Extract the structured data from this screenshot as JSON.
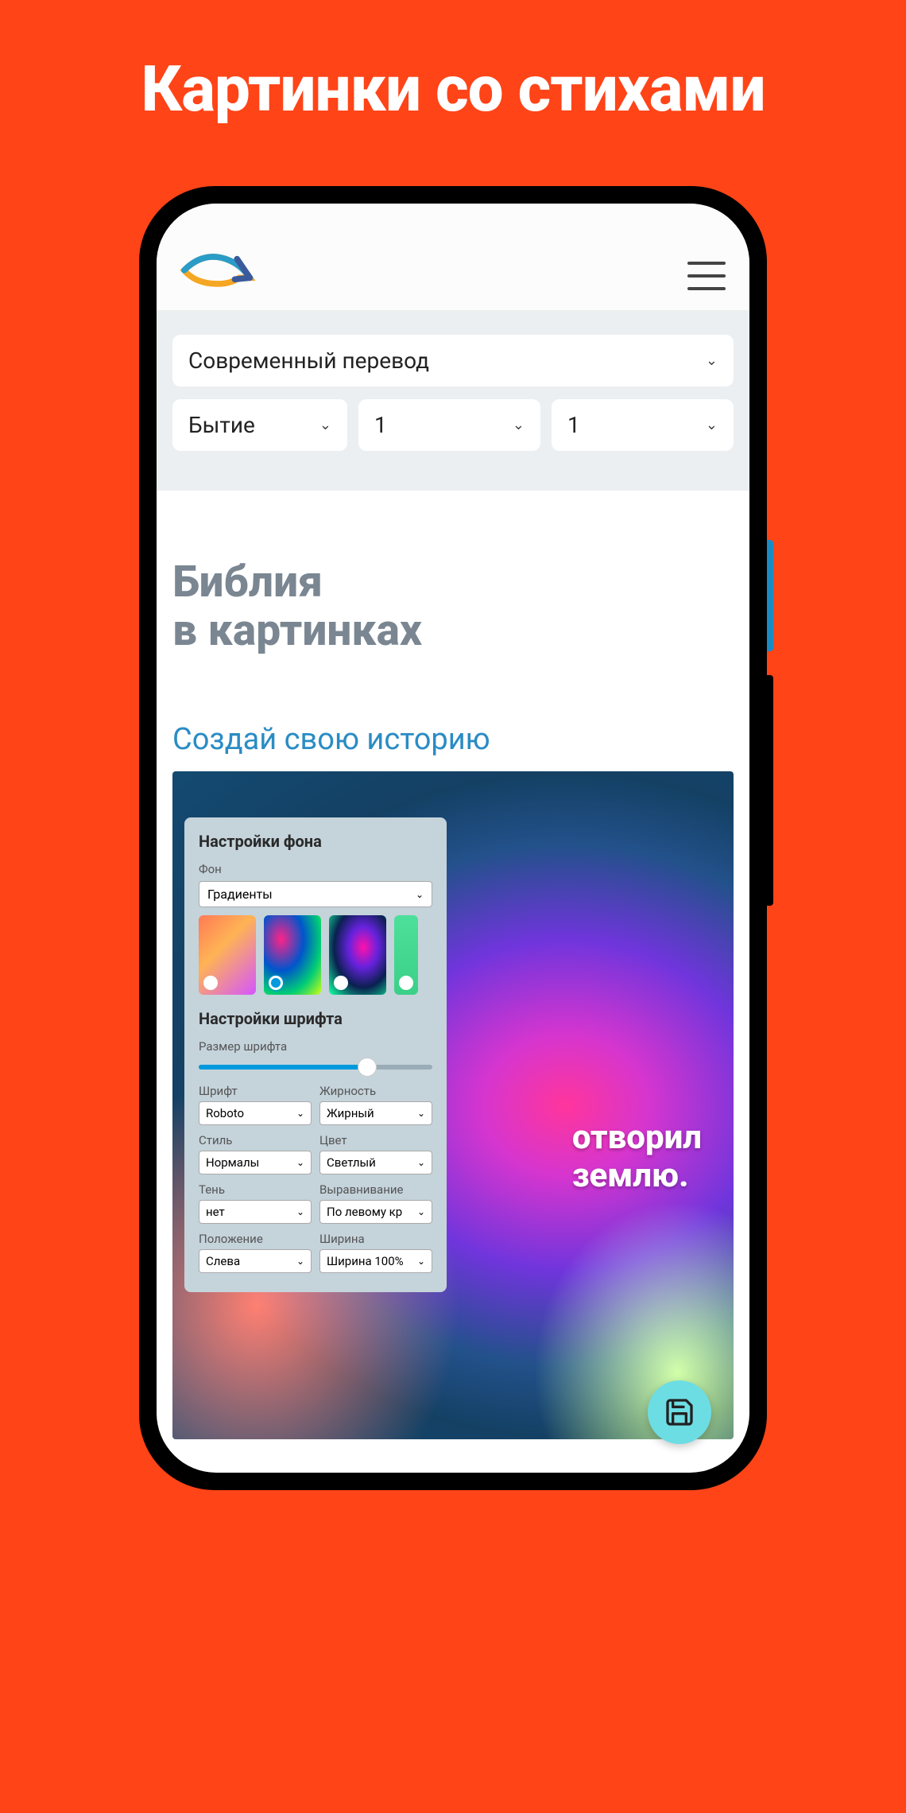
{
  "promo": {
    "title": "Картинки со стихами"
  },
  "selectors": {
    "translation": "Современный перевод",
    "book": "Бытие",
    "chapter": "1",
    "verse": "1"
  },
  "page": {
    "title_line1": "Библия",
    "title_line2": "в картинках",
    "subtitle": "Создай свою историю"
  },
  "verse_preview": {
    "line1": "отворил",
    "line2": "землю."
  },
  "panel": {
    "bg_title": "Настройки фона",
    "bg_label": "Фон",
    "bg_value": "Градиенты",
    "font_title": "Настройки шрифта",
    "fontsize_label": "Размер шрифта",
    "fields": {
      "font": {
        "label": "Шрифт",
        "value": "Roboto"
      },
      "weight": {
        "label": "Жирность",
        "value": "Жирный"
      },
      "style": {
        "label": "Стиль",
        "value": "Нормалы"
      },
      "color": {
        "label": "Цвет",
        "value": "Светлый"
      },
      "shadow": {
        "label": "Тень",
        "value": "нет"
      },
      "align": {
        "label": "Выравнивание",
        "value": "По левому кр"
      },
      "position": {
        "label": "Положение",
        "value": "Слева"
      },
      "width": {
        "label": "Ширина",
        "value": "Ширина 100%"
      }
    }
  }
}
